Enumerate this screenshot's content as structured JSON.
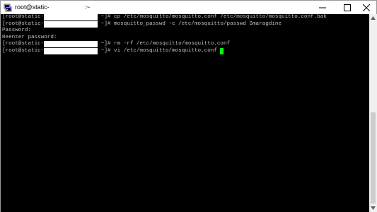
{
  "window": {
    "title_prefix": "root@static-",
    "title_suffix": ":~"
  },
  "terminal": {
    "lines": [
      {
        "prompt_start": "[root@static-",
        "prompt_end": " ~]# ",
        "text": "cp /etc/mosquitto/mosquitto.conf /etc/mosquitto/mosquitto.conf.bak"
      },
      {
        "prompt_start": "[root@static-",
        "prompt_end": " ~]# ",
        "text": "mosquitto_passwd -c /etc/mosquitto/passwd Smaragdine"
      },
      {
        "text": "Password:"
      },
      {
        "text": "Reenter password:"
      },
      {
        "prompt_start": "[root@static-",
        "prompt_end": " ~]# ",
        "text": "rm -rf /etc/mosquitto/mosquitto.conf"
      },
      {
        "prompt_start": "[root@static-",
        "prompt_end": " ~]# ",
        "text": "vi /etc/mosquitto/mosquitto.conf "
      }
    ]
  },
  "colors": {
    "terminal_bg": "#000000",
    "terminal_fg": "#c0c0c0",
    "cursor": "#00ff00",
    "redaction": "#ffffff"
  },
  "icons": [
    "putty-icon",
    "minimize-icon",
    "maximize-icon",
    "close-icon",
    "scroll-up-icon",
    "scroll-down-icon"
  ]
}
